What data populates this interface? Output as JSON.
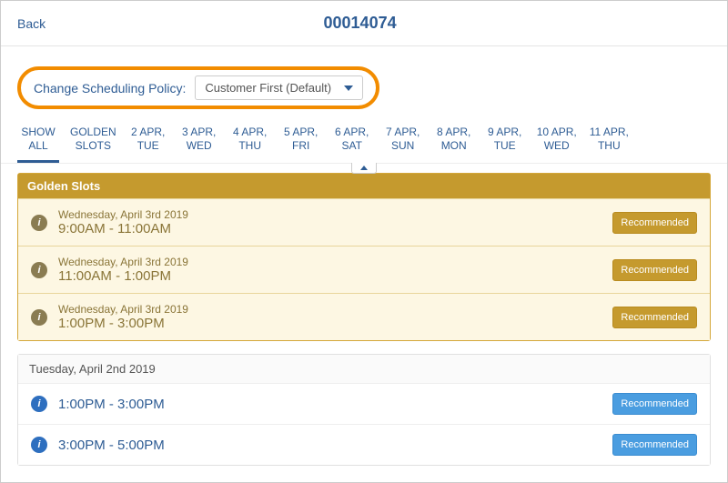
{
  "header": {
    "back": "Back",
    "title": "00014074"
  },
  "policy": {
    "label": "Change Scheduling Policy:",
    "value": "Customer First (Default)"
  },
  "tabs": [
    {
      "line1": "SHOW",
      "line2": "ALL",
      "active": true
    },
    {
      "line1": "GOLDEN",
      "line2": "SLOTS"
    },
    {
      "line1": "2 APR,",
      "line2": "TUE"
    },
    {
      "line1": "3 APR,",
      "line2": "WED"
    },
    {
      "line1": "4 APR,",
      "line2": "THU"
    },
    {
      "line1": "5 APR,",
      "line2": "FRI"
    },
    {
      "line1": "6 APR,",
      "line2": "SAT"
    },
    {
      "line1": "7 APR,",
      "line2": "SUN"
    },
    {
      "line1": "8 APR,",
      "line2": "MON"
    },
    {
      "line1": "9 APR,",
      "line2": "TUE"
    },
    {
      "line1": "10 APR,",
      "line2": "WED"
    },
    {
      "line1": "11 APR,",
      "line2": "THU"
    }
  ],
  "golden": {
    "header": "Golden Slots",
    "slots": [
      {
        "date": "Wednesday, April 3rd 2019",
        "time": "9:00AM - 11:00AM",
        "badge": "Recommended"
      },
      {
        "date": "Wednesday, April 3rd 2019",
        "time": "11:00AM - 1:00PM",
        "badge": "Recommended"
      },
      {
        "date": "Wednesday, April 3rd 2019",
        "time": "1:00PM - 3:00PM",
        "badge": "Recommended"
      }
    ]
  },
  "regular": {
    "header": "Tuesday, April 2nd 2019",
    "slots": [
      {
        "time": "1:00PM - 3:00PM",
        "badge": "Recommended"
      },
      {
        "time": "3:00PM - 5:00PM",
        "badge": "Recommended"
      }
    ]
  },
  "info_glyph": "i"
}
